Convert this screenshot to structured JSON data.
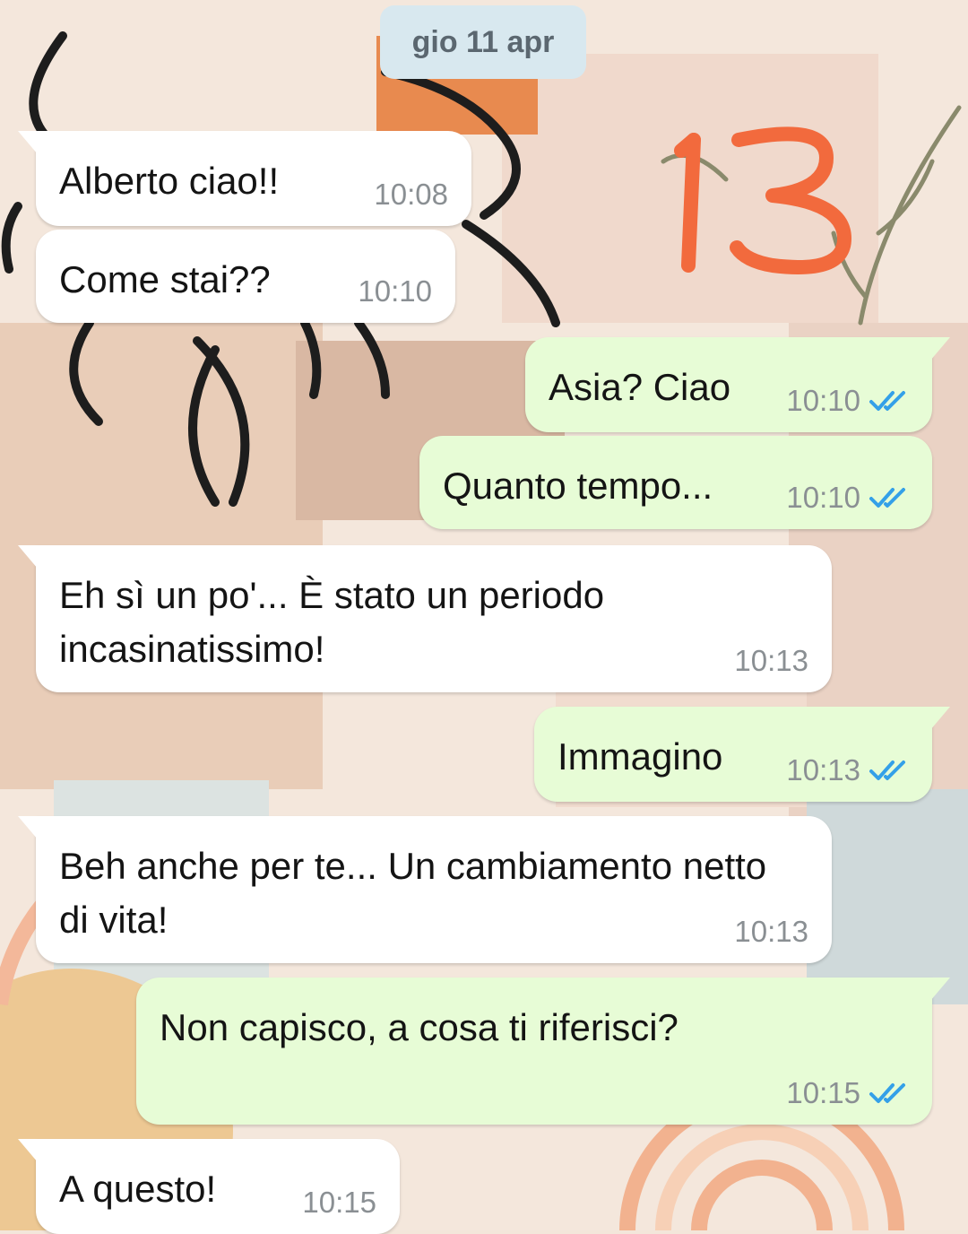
{
  "date_chip": "gio 11 apr",
  "sticker_text": "13",
  "colors": {
    "incoming_bubble": "#ffffff",
    "outgoing_bubble": "#e7fcd6",
    "read_check": "#34a0e8",
    "sticker": "#f26a3d",
    "date_chip": "#d8e8ef"
  },
  "messages": [
    {
      "dir": "in",
      "text": "Alberto ciao!!",
      "time": "10:08",
      "status_icon": null
    },
    {
      "dir": "in",
      "text": "Come stai??",
      "time": "10:10",
      "status_icon": null
    },
    {
      "dir": "out",
      "text": "Asia? Ciao",
      "time": "10:10",
      "status_icon": "double-check-read-icon"
    },
    {
      "dir": "out",
      "text": "Quanto tempo...",
      "time": "10:10",
      "status_icon": "double-check-read-icon"
    },
    {
      "dir": "in",
      "text": "Eh sì un po'... È stato un periodo incasinatissimo!",
      "time": "10:13",
      "status_icon": null
    },
    {
      "dir": "out",
      "text": "Immagino",
      "time": "10:13",
      "status_icon": "double-check-read-icon"
    },
    {
      "dir": "in",
      "text": "Beh anche per te... Un cambiamento netto di vita!",
      "time": "10:13",
      "status_icon": null
    },
    {
      "dir": "out",
      "text": "Non capisco, a cosa ti riferisci?",
      "time": "10:15",
      "status_icon": "double-check-read-icon"
    },
    {
      "dir": "in",
      "text": "A questo!",
      "time": "10:15",
      "status_icon": null
    }
  ]
}
